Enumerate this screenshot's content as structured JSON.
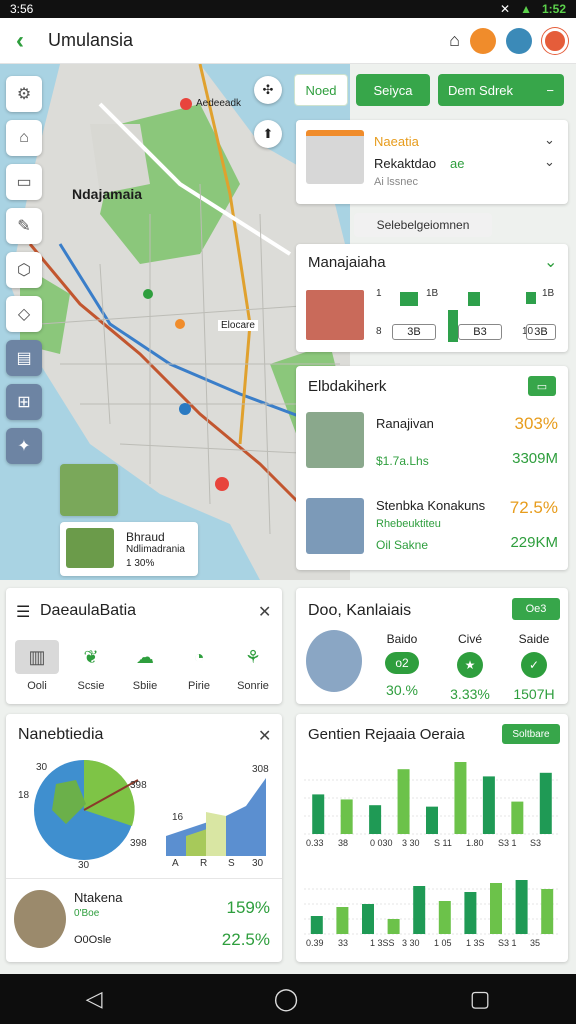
{
  "status": {
    "time": "3:56",
    "right": "1:52"
  },
  "appbar": {
    "title": "Umulansia"
  },
  "map": {
    "city_label": "Ndajamaia",
    "pin_label": "Aedeeadk",
    "district_label": "Elocare",
    "card1_title": "Bhraud",
    "card1_sub": "Ndlimadrania",
    "card1_val": "1 30%"
  },
  "top_buttons": {
    "b1": "Noed",
    "b2": "Seiyca",
    "b3": "Dem Sdrek",
    "b3_icon": "−"
  },
  "info_card": {
    "title": "Naeatia",
    "subtitle": "Rekaktdao",
    "subtitle_val": "ae",
    "note": "Ai lssnec"
  },
  "pill": {
    "label": "Selebelgeiomnen"
  },
  "mana_card": {
    "title": "Manajaiaha",
    "labels_top": [
      "1",
      "1B",
      "1B"
    ],
    "labels_bottom": [
      "8",
      "3B",
      "B3",
      "10",
      "3B"
    ]
  },
  "elb_card": {
    "title": "Elbdakiherk",
    "badge": "",
    "items": [
      {
        "title": "Ranajivan",
        "sub": "$1.7a.Lhs",
        "pct": "303%",
        "val": "3309M"
      },
      {
        "title": "Stenbka Konakuns",
        "sub": "Rhebeuktiteu",
        "sub2": "Oil Sakne",
        "pct": "72.5%",
        "val": "229KM"
      }
    ]
  },
  "deadula": {
    "title": "DaeaulaBatia",
    "items": [
      {
        "label": "Ooli"
      },
      {
        "label": "Scsie"
      },
      {
        "label": "Sbiie"
      },
      {
        "label": "Pirie"
      },
      {
        "label": "Sonrie"
      }
    ]
  },
  "doo_card": {
    "title": "Doo, Kanlaiais",
    "btn": "Oe3",
    "kpis": [
      {
        "label": "Baido",
        "icon": "o2",
        "val": "30.%"
      },
      {
        "label": "Civé",
        "icon": "★",
        "val": "3.33%"
      },
      {
        "label": "Saide",
        "icon": "✓",
        "val": "1507H"
      }
    ]
  },
  "nane": {
    "title": "Nanebtiedia",
    "pie_labels": [
      "30",
      "18",
      "30",
      "398",
      "398"
    ],
    "axis_labels": [
      "A",
      "R",
      "S",
      "30"
    ],
    "bar_top": "308",
    "bar_mid": "16",
    "person_title": "Ntakena",
    "person_sub": "0'Boe",
    "person_sub2": "O0Osle",
    "pct1": "159%",
    "pct2": "22.5%"
  },
  "gentien": {
    "title": "Gentien Rejaaia Oeraia",
    "btn": "Soltbare",
    "row1_labels": [
      "0.33",
      "38",
      "0 030",
      "3 30",
      "S 11",
      "1.80",
      "S3 1",
      "S3"
    ],
    "row2_labels": [
      "0.39",
      "33",
      "1 3SS",
      "3 30",
      "1 05",
      "1 3S",
      "S3 1",
      "35"
    ],
    "row1_values": [
      55,
      48,
      40,
      90,
      38,
      100,
      80,
      45,
      85
    ],
    "row2_values": [
      30,
      45,
      50,
      25,
      80,
      55,
      70,
      85,
      90,
      75
    ]
  },
  "colors": {
    "green": "#2e9e3d",
    "orange": "#e79c1c",
    "light_green": "#7ec446"
  }
}
